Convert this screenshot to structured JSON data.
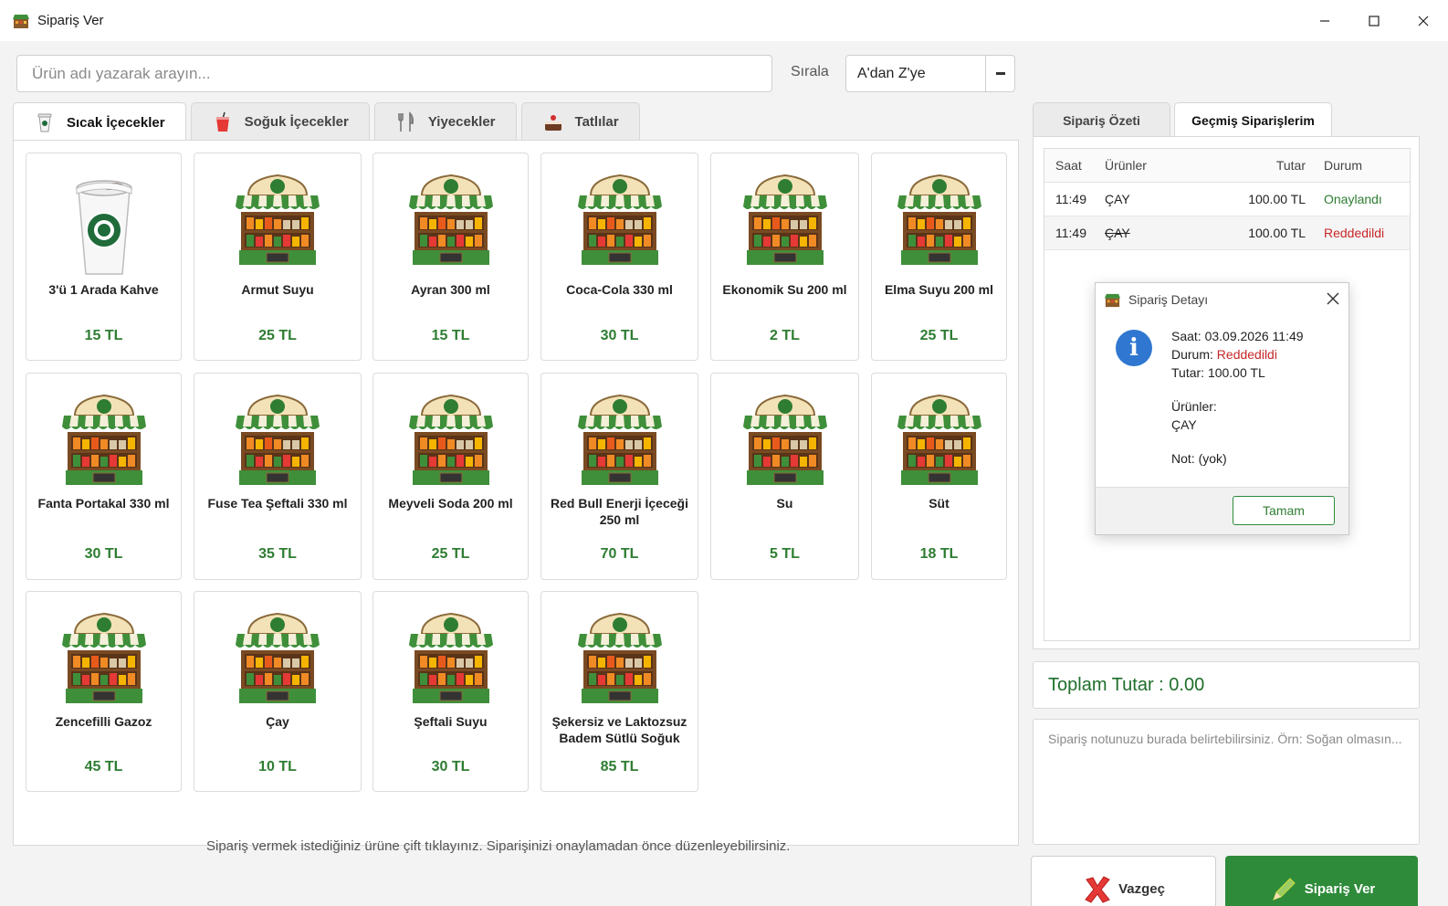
{
  "window": {
    "title": "Sipariş Ver"
  },
  "search": {
    "placeholder": "Ürün adı yazarak arayın..."
  },
  "sort": {
    "label": "Sırala",
    "value": "A'dan Z'ye"
  },
  "tabs": [
    {
      "label": "Sıcak İçecekler",
      "icon": "hot-drink-icon",
      "active": true
    },
    {
      "label": "Soğuk İçecekler",
      "icon": "cold-drink-icon",
      "active": false
    },
    {
      "label": "Yiyecekler",
      "icon": "cutlery-icon",
      "active": false
    },
    {
      "label": "Tatlılar",
      "icon": "cake-icon",
      "active": false
    }
  ],
  "products": [
    {
      "name": "3'ü 1 Arada Kahve",
      "price": "15 TL",
      "image": "coffee-cup"
    },
    {
      "name": "Armut Suyu",
      "price": "25 TL",
      "image": "market-stall"
    },
    {
      "name": "Ayran 300 ml",
      "price": "15 TL",
      "image": "market-stall"
    },
    {
      "name": "Coca-Cola 330 ml",
      "price": "30 TL",
      "image": "market-stall"
    },
    {
      "name": "Ekonomik Su 200 ml",
      "price": "2 TL",
      "image": "market-stall"
    },
    {
      "name": "Elma Suyu 200 ml",
      "price": "25 TL",
      "image": "market-stall"
    },
    {
      "name": "Fanta Portakal 330 ml",
      "price": "30 TL",
      "image": "market-stall"
    },
    {
      "name": "Fuse Tea Şeftali 330 ml",
      "price": "35 TL",
      "image": "market-stall"
    },
    {
      "name": "Meyveli Soda 200 ml",
      "price": "25 TL",
      "image": "market-stall"
    },
    {
      "name": "Red Bull Enerji İçeceği 250 ml",
      "price": "70 TL",
      "image": "market-stall"
    },
    {
      "name": "Su",
      "price": "5 TL",
      "image": "market-stall"
    },
    {
      "name": "Süt",
      "price": "18 TL",
      "image": "market-stall"
    },
    {
      "name": "Zencefilli Gazoz",
      "price": "45 TL",
      "image": "market-stall"
    },
    {
      "name": "Çay",
      "price": "10 TL",
      "image": "market-stall"
    },
    {
      "name": "Şeftali Suyu",
      "price": "30 TL",
      "image": "market-stall"
    },
    {
      "name": "Şekersiz ve Laktozsuz Badem Sütlü Soğuk",
      "price": "85 TL",
      "image": "market-stall"
    }
  ],
  "hint": "Sipariş vermek istediğiniz ürüne çift tıklayınız. Siparişinizi onaylamadan önce düzenleyebilirsiniz.",
  "right_tabs": [
    {
      "label": "Sipariş Özeti",
      "active": false
    },
    {
      "label": "Geçmiş Siparişlerim",
      "active": true
    }
  ],
  "orders": {
    "columns": [
      "Saat",
      "Ürünler",
      "Tutar",
      "Durum"
    ],
    "rows": [
      {
        "time": "11:49",
        "products": "ÇAY",
        "amount": "100.00 TL",
        "status": "Onaylandı",
        "status_color": "#2e7d32",
        "struck": false
      },
      {
        "time": "11:49",
        "products": "ÇAY",
        "amount": "100.00 TL",
        "status": "Reddedildi",
        "status_color": "#c62828",
        "struck": true
      }
    ]
  },
  "dialog": {
    "title": "Sipariş Detayı",
    "time_label": "Saat:",
    "time_value": "03.09.2026 11:49",
    "status_label": "Durum:",
    "status_value": "Reddedildi",
    "amount_label": "Tutar:",
    "amount_value": "100.00 TL",
    "products_label": "Ürünler:",
    "products_value": "ÇAY",
    "note_label": "Not:",
    "note_value": "(yok)",
    "ok_label": "Tamam"
  },
  "total": {
    "label": "Toplam Tutar",
    "value": "0.00"
  },
  "note": {
    "placeholder": "Sipariş notunuzu burada belirtebilirsiniz. Örn: Soğan olmasın..."
  },
  "buttons": {
    "cancel": "Vazgeç",
    "order": "Sipariş Ver"
  },
  "colors": {
    "accent_green": "#2e8b3a",
    "price_green": "#2e7d32",
    "rejected_red": "#c62828"
  }
}
